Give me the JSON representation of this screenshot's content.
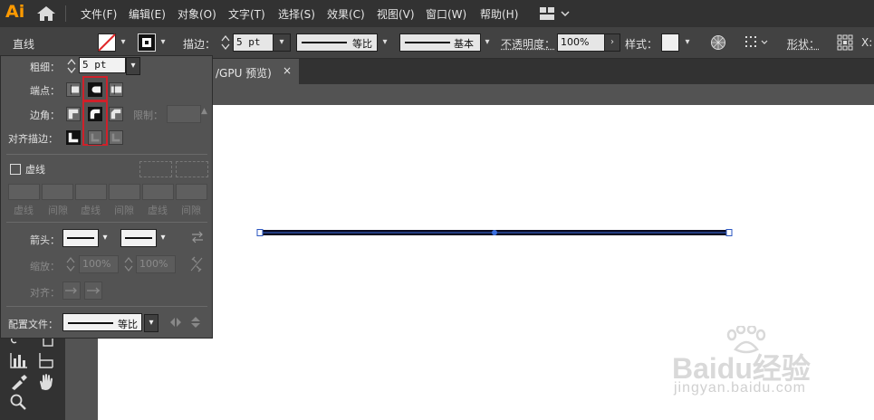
{
  "app": {
    "logo": "Ai"
  },
  "menu": [
    "文件(F)",
    "编辑(E)",
    "对象(O)",
    "文字(T)",
    "选择(S)",
    "效果(C)",
    "视图(V)",
    "窗口(W)",
    "帮助(H)"
  ],
  "control_bar": {
    "object_type": "直线",
    "stroke_label": "描边：",
    "stroke_weight": "5 pt",
    "profile_value": "等比",
    "brush_value": "基本",
    "opacity_label": "不透明度：",
    "opacity_value": "100%",
    "style_label": "样式：",
    "shape_label": "形状：",
    "x_label": "X:"
  },
  "document_tab": {
    "title": "/GPU 预览)",
    "close": "×"
  },
  "stroke_panel": {
    "weight_label": "粗细：",
    "weight_value": "5 pt",
    "cap_label": "端点：",
    "corner_label": "边角：",
    "limit_label": "限制：",
    "align_label": "对齐描边：",
    "dashed_label": "虚线",
    "dash_labels": [
      "虚线",
      "间隙",
      "虚线",
      "间隙",
      "虚线",
      "间隙"
    ],
    "arrow_label": "箭头：",
    "scale_label": "缩放：",
    "scale_start": "100%",
    "scale_end": "100%",
    "align_arrow_label": "对齐：",
    "profile_label": "配置文件：",
    "profile_value": "等比",
    "selected_cap": "round-cap",
    "selected_corner": "round-join",
    "selected_align": "center"
  },
  "watermark": {
    "brand": "Baidu经验",
    "url": "jingyan.baidu.com"
  },
  "colors": {
    "accent": "#ff9a00",
    "highlight": "#d0202a",
    "line": "#0a0a1e",
    "anchor": "#3a6fe0"
  }
}
